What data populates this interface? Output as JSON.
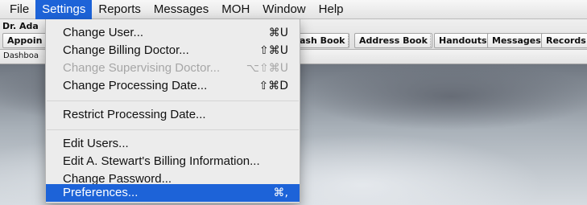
{
  "menubar": {
    "items": [
      "File",
      "Settings",
      "Reports",
      "Messages",
      "MOH",
      "Window",
      "Help"
    ],
    "active_index": 1
  },
  "toolbar": {
    "doctor_label": "Dr. Ada",
    "buttons": [
      "Appoin",
      "ash Book",
      "Address Book",
      "Handouts",
      "Messages",
      "Records"
    ]
  },
  "tabs": {
    "dashboard": "Dashboa"
  },
  "settings_menu": {
    "items": [
      {
        "label": "Change User...",
        "shortcut": "⌘U",
        "enabled": true
      },
      {
        "label": "Change Billing Doctor...",
        "shortcut": "⇧⌘U",
        "enabled": true
      },
      {
        "label": "Change Supervising Doctor...",
        "shortcut": "⌥⇧⌘U",
        "enabled": false
      },
      {
        "label": "Change Processing Date...",
        "shortcut": "⇧⌘D",
        "enabled": true
      },
      {
        "label": "Restrict Processing Date...",
        "shortcut": "",
        "enabled": true
      },
      {
        "label": "Edit Users...",
        "shortcut": "",
        "enabled": true
      },
      {
        "label": "Edit A. Stewart's Billing Information...",
        "shortcut": "",
        "enabled": true
      },
      {
        "label": "Change Password...",
        "shortcut": "",
        "enabled": true
      },
      {
        "label": "Preferences...",
        "shortcut": "⌘,",
        "enabled": true
      }
    ],
    "selected_index": 8
  },
  "colors": {
    "selection": "#1d63d8"
  }
}
